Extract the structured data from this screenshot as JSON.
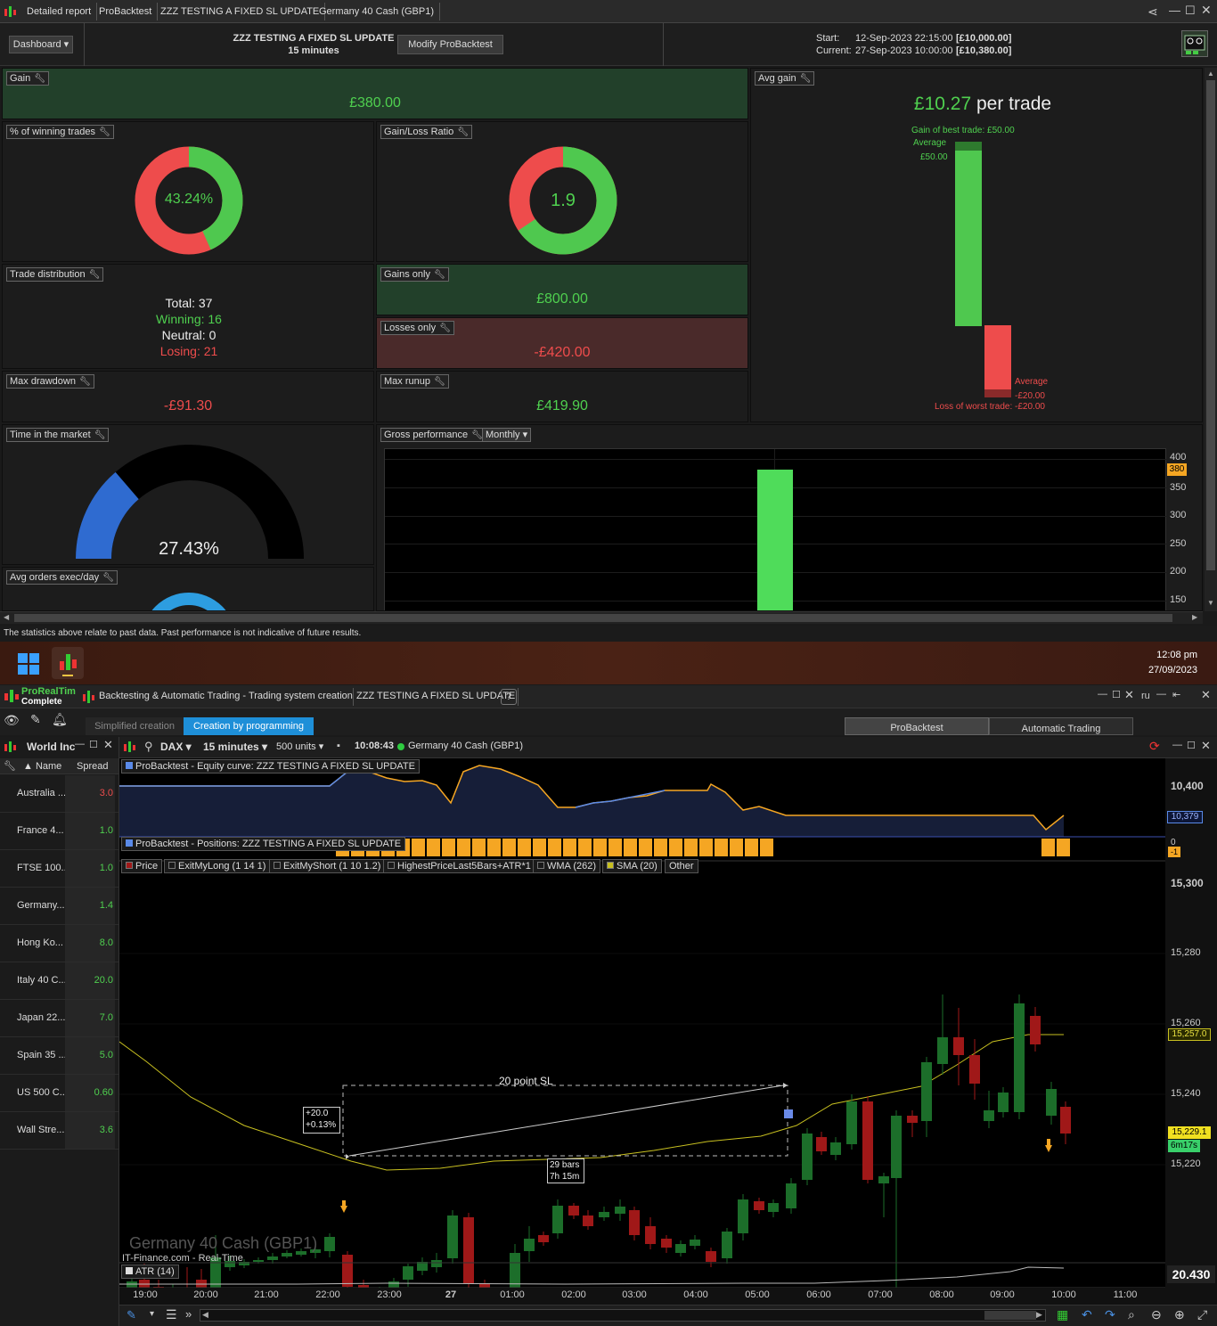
{
  "top_tabs": [
    "Detailed report",
    "ProBacktest",
    "ZZZ TESTING A FIXED SL UPDATE",
    "Germany 40 Cash (GBP1)"
  ],
  "header": {
    "dashboard": "Dashboard",
    "title": "ZZZ TESTING A FIXED SL UPDATE",
    "subtitle": "15 minutes",
    "modify": "Modify ProBacktest",
    "start_label": "Start:",
    "start_date": "12-Sep-2023 22:15:00",
    "start_capital": "[£10,000.00]",
    "current_label": "Current:",
    "current_date": "27-Sep-2023 10:00:00",
    "current_capital": "[£10,380.00]"
  },
  "gain": {
    "label": "Gain",
    "value": "£380.00"
  },
  "winning": {
    "label": "% of winning trades",
    "value": "43.24%",
    "fraction": 0.4324
  },
  "gainloss": {
    "label": "Gain/Loss Ratio",
    "value": "1.9",
    "fraction": 0.655
  },
  "avg_gain": {
    "label": "Avg gain",
    "value": "£10.27",
    "suffix": "per trade",
    "best": "Gain of best trade: £50.00",
    "avg_label": "Average",
    "avg_gain": "£50.00",
    "avg_loss_label": "Average",
    "avg_loss": "-£20.00",
    "worst": "Loss of worst trade: -£20.00"
  },
  "distribution": {
    "label": "Trade distribution",
    "total_l": "Total:",
    "total": "37",
    "win_l": "Winning:",
    "win": "16",
    "neu_l": "Neutral:",
    "neu": "0",
    "los_l": "Losing:",
    "los": "21"
  },
  "gains_only": {
    "label": "Gains only",
    "value": "£800.00"
  },
  "losses_only": {
    "label": "Losses only",
    "value": "-£420.00"
  },
  "max_dd": {
    "label": "Max drawdown",
    "value": "-£91.30"
  },
  "max_ru": {
    "label": "Max runup",
    "value": "£419.90"
  },
  "time_market": {
    "label": "Time in the market",
    "value": "27.43%",
    "fraction": 0.2743
  },
  "avg_orders": {
    "label": "Avg orders exec/day"
  },
  "gross": {
    "label": "Gross performance",
    "period": "Monthly",
    "ticks": [
      "400",
      "350",
      "300",
      "250",
      "200",
      "150"
    ],
    "current": "380"
  },
  "disclaimer": "The statistics above relate to past data. Past performance is not indicative of future results.",
  "taskbar": {
    "time": "12:08 pm",
    "date": "27/09/2023"
  },
  "lower": {
    "app": "ProRealTim",
    "edition": "Complete",
    "title": "Backtesting & Automatic Trading - Trading system creation",
    "title2": "ZZZ TESTING A FIXED SL UPDATE",
    "simplified": "Simplified creation",
    "programming": "Creation by programming",
    "probacktest": "ProBacktest",
    "automatic": "Automatic Trading",
    "ru": "ru"
  },
  "watchlist": {
    "title": "World Inc",
    "col_name": "Name",
    "col_spread": "Spread",
    "rows": [
      {
        "name": "Australia ...",
        "spread": "3.0",
        "color": "#ee4c4c"
      },
      {
        "name": "France 4...",
        "spread": "1.0",
        "color": "#4fd04f"
      },
      {
        "name": "FTSE 100...",
        "spread": "1.0",
        "color": "#4fd04f"
      },
      {
        "name": "Germany...",
        "spread": "1.4",
        "color": "#4fd04f"
      },
      {
        "name": "Hong Ko...",
        "spread": "8.0",
        "color": "#4fd04f"
      },
      {
        "name": "Italy 40 C...",
        "spread": "20.0",
        "color": "#4fd04f"
      },
      {
        "name": "Japan 22...",
        "spread": "7.0",
        "color": "#4fd04f"
      },
      {
        "name": "Spain 35 ...",
        "spread": "5.0",
        "color": "#4fd04f"
      },
      {
        "name": "US 500 C...",
        "spread": "0.60",
        "color": "#4fd04f"
      },
      {
        "name": "Wall Stre...",
        "spread": "3.6",
        "color": "#4fd04f"
      }
    ]
  },
  "chart": {
    "instrument": "DAX",
    "timeframe": "15 minutes",
    "units": "500 units",
    "time": "10:08:43",
    "name": "Germany 40 Cash (GBP1)",
    "equity_label": "ProBacktest - Equity curve: ZZZ TESTING A FIXED SL UPDATE",
    "positions_label": "ProBacktest - Positions: ZZZ TESTING A FIXED SL UPDATE",
    "equity_ticks": [
      "10,400"
    ],
    "equity_current": "10,379",
    "pos_ticks": [
      "0"
    ],
    "pos_current": "-1",
    "legend": [
      "Price",
      "ExitMyLong (1 14 1)",
      "ExitMyShort (1 10 1.2)",
      "HighestPriceLast5Bars+ATR*1",
      "WMA (262)",
      "SMA (20)",
      "Other"
    ],
    "price_ticks": [
      "15,300",
      "15,280",
      "15,260",
      "15,240",
      "15,220"
    ],
    "price_sma": "15,257.0",
    "price_last": "15,229.1",
    "countdown": "6m17s",
    "annot_sl": "20 point SL",
    "annot_box1": "+20.0",
    "annot_box2": "+0.13%",
    "annot_bars": "29 bars",
    "annot_dur": "7h 15m",
    "watermark": "Germany 40 Cash (GBP1)",
    "source": "IT-Finance.com - Real-Time",
    "atr_label": "ATR (14)",
    "atr_value": "20.430",
    "x_ticks": [
      "19:00",
      "20:00",
      "21:00",
      "22:00",
      "23:00",
      "27",
      "01:00",
      "02:00",
      "03:00",
      "04:00",
      "05:00",
      "06:00",
      "07:00",
      "08:00",
      "09:00",
      "10:00",
      "11:00"
    ]
  },
  "colors": {
    "up": "#1c6e2a",
    "down": "#a01818",
    "green": "#4fd04f",
    "red": "#ee4c4c",
    "orange": "#f5a623"
  }
}
